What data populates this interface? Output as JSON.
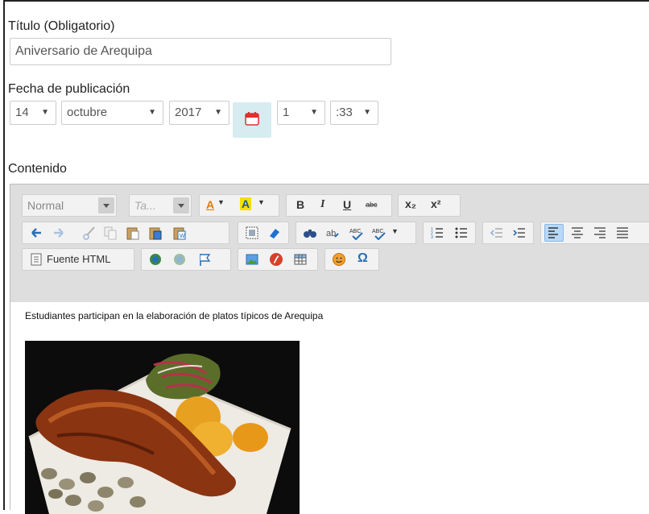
{
  "title_field": {
    "label": "Título (Obligatorio)",
    "value": "Aniversario de Arequipa"
  },
  "date_field": {
    "label": "Fecha de publicación",
    "day": "14",
    "month": "octubre",
    "year": "2017",
    "hour": "1",
    "minute": ":33",
    "calendar_icon": "calendar-icon"
  },
  "content_field": {
    "label": "Contenido"
  },
  "editor": {
    "format_combo": "Normal",
    "size_combo": "Ta...",
    "source_label": "Fuente HTML",
    "bold": "B",
    "italic": "I",
    "underline": "U",
    "strike": "abc",
    "subscript": "x₂",
    "superscript": "x²",
    "text_color_letter": "A",
    "bg_color_letter": "A",
    "omega": "Ω",
    "body_text": "Estudiantes participan en la elaboración de platos típicos de Arequipa",
    "image_description_icon": "food-photo"
  },
  "colors": {
    "accent": "#2a6fb5",
    "calendar_bg": "#d7ecf0",
    "toolbar_bg": "#dedede"
  }
}
